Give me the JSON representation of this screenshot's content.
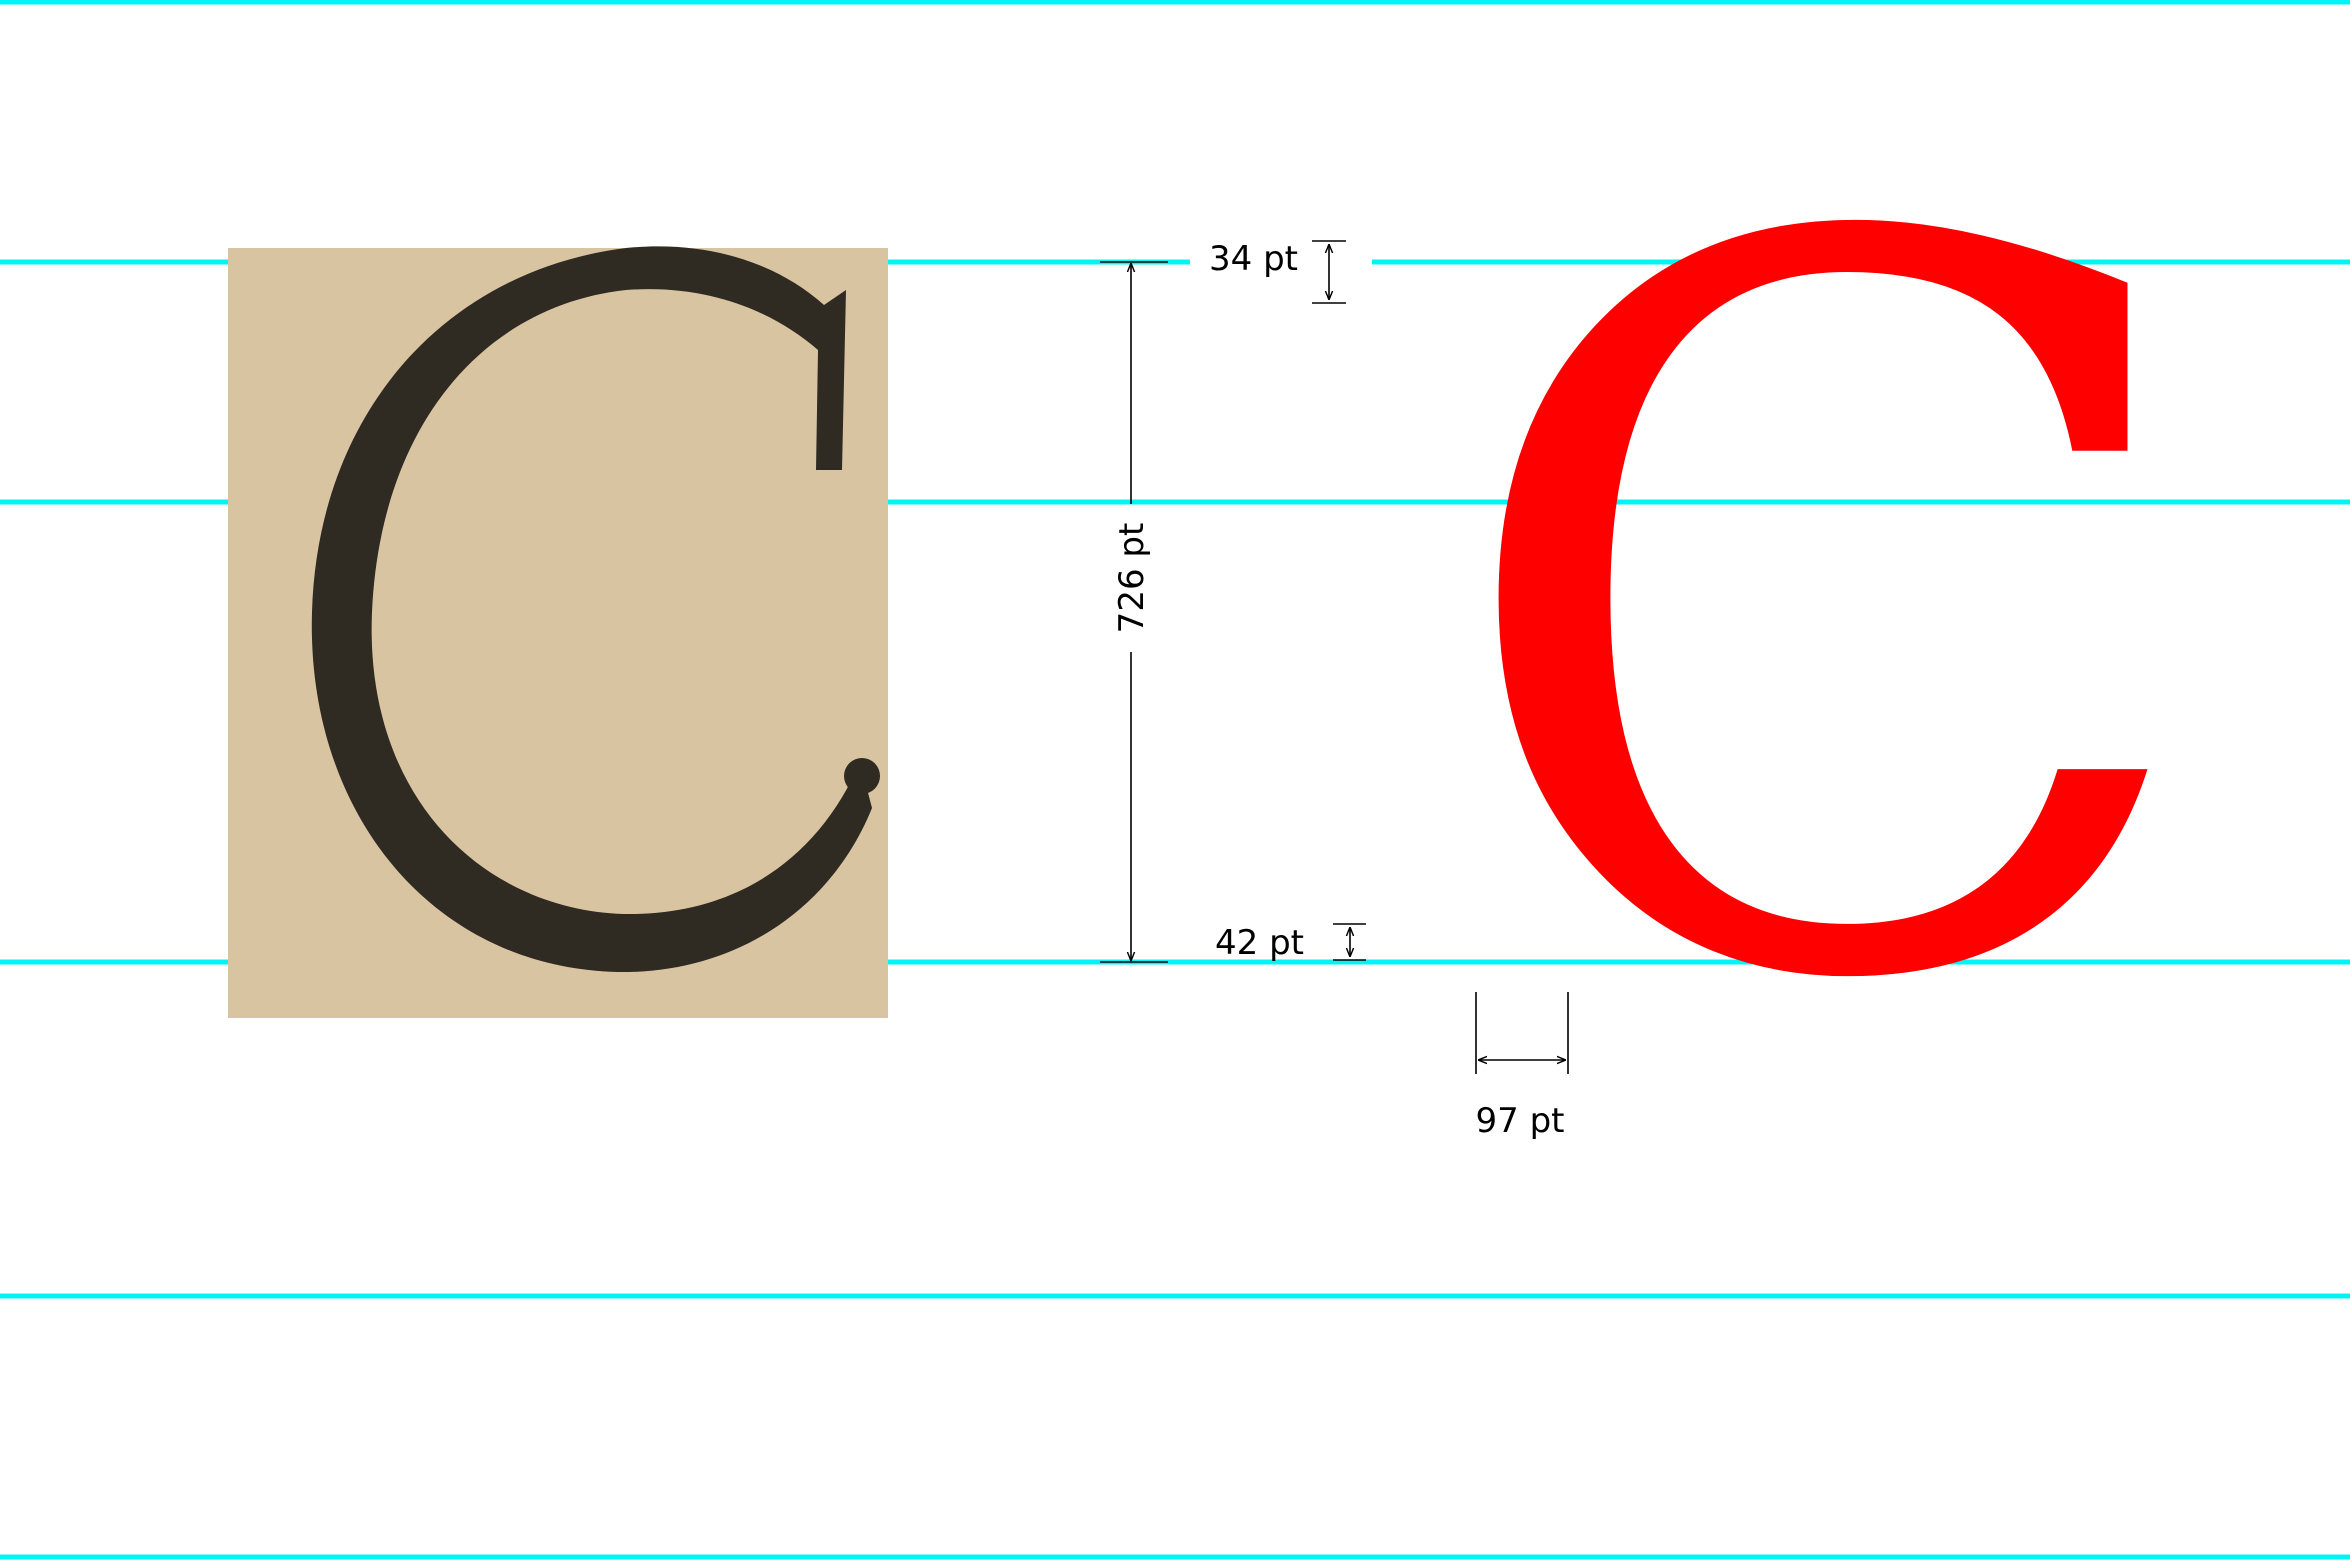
{
  "colors": {
    "guide_line": "#00f4f4",
    "scan_paper": "#d9c4a2",
    "scan_ink": "#2f2a22",
    "glyph": "#ff0000",
    "dimension": "#000000"
  },
  "scan_image": {
    "depicts": "scanned printed letter C on aged paper"
  },
  "glyph_sample": {
    "character": "C"
  },
  "measurements": {
    "top_overshoot": "34 pt",
    "cap_height": "726 pt",
    "bottom_overshoot": "42 pt",
    "stroke_width": "97 pt"
  }
}
